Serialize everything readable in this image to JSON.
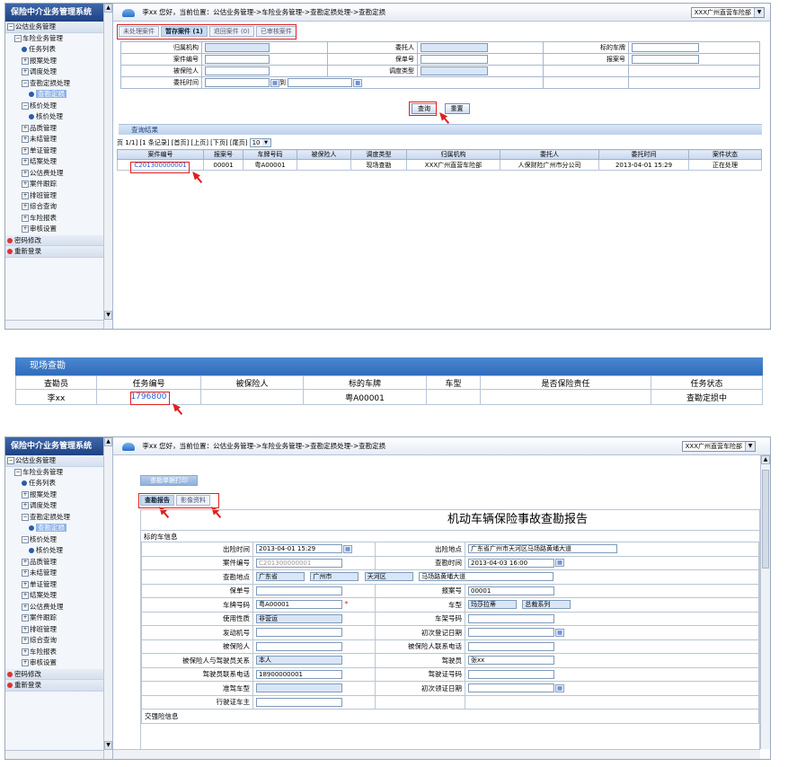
{
  "app": {
    "title": "保险中介业务管理系统",
    "branch_select": "XXX广州直营车险部"
  },
  "sidebar": {
    "items": [
      {
        "label": "公估业务管理",
        "level": 0,
        "icon": "collapse"
      },
      {
        "label": "车险业务管理",
        "level": 1,
        "icon": "collapse"
      },
      {
        "label": "任务列表",
        "level": 2,
        "icon": "dot"
      },
      {
        "label": "报案处理",
        "level": 2,
        "icon": "expand"
      },
      {
        "label": "调度处理",
        "level": 2,
        "icon": "expand"
      },
      {
        "label": "查勘定损处理",
        "level": 2,
        "icon": "collapse"
      },
      {
        "label": "查勘定损",
        "level": 3,
        "icon": "dot",
        "selected": true
      },
      {
        "label": "核价处理",
        "level": 2,
        "icon": "collapse"
      },
      {
        "label": "核价处理",
        "level": 3,
        "icon": "dot"
      },
      {
        "label": "品质管理",
        "level": 2,
        "icon": "expand"
      },
      {
        "label": "未结管理",
        "level": 2,
        "icon": "expand"
      },
      {
        "label": "单证管理",
        "level": 2,
        "icon": "expand"
      },
      {
        "label": "结案处理",
        "level": 2,
        "icon": "expand"
      },
      {
        "label": "公估费处理",
        "level": 2,
        "icon": "expand"
      },
      {
        "label": "案件跟踪",
        "level": 2,
        "icon": "expand"
      },
      {
        "label": "排班管理",
        "level": 2,
        "icon": "expand"
      },
      {
        "label": "综合查询",
        "level": 2,
        "icon": "expand"
      },
      {
        "label": "车险报表",
        "level": 2,
        "icon": "expand"
      },
      {
        "label": "审核设置",
        "level": 2,
        "icon": "expand"
      },
      {
        "label": "密码修改",
        "level": 0,
        "icon": "dot"
      },
      {
        "label": "重新登录",
        "level": 0,
        "icon": "dot"
      }
    ]
  },
  "panel1": {
    "breadcrumb": "李xx 您好，当前位置：公估业务管理->车险业务管理->查勘定损处理->查勘定损",
    "tabs": [
      "未处理案件",
      "暂存案件 (1)",
      "退回案件 (0)",
      "已审核案件"
    ],
    "form": {
      "org_label": "归属机构",
      "principal_label": "委托人",
      "plate_label": "标的车牌",
      "case_label": "案件编号",
      "policy_label": "保单号",
      "report_label": "报案号",
      "insured_label": "被保险人",
      "dispatch_label": "调度类型",
      "time_label": "委托时间",
      "to_label": "到"
    },
    "query_button": "查询",
    "reset_button": "重置",
    "results_title": "查询结果",
    "pager": "页 1/1] [1 条记录] [首页] [上页] [下页] [尾页]",
    "page_size": "10",
    "columns": [
      "案件编号",
      "报案号",
      "车牌号码",
      "被保险人",
      "调度类型",
      "归属机构",
      "委托人",
      "委托时间",
      "案件状态"
    ],
    "rows": [
      [
        "C201300000001",
        "00001",
        "粤A00001",
        "",
        "现场查勘",
        "XXX广州直营车险部",
        "人保财险广州市分公司",
        "2013-04-01 15:29",
        "正在处理"
      ]
    ]
  },
  "field_survey": {
    "title": "现场查勘",
    "columns": [
      "查勘员",
      "任务编号",
      "被保险人",
      "标的车牌",
      "车型",
      "是否保险责任",
      "任务状态"
    ],
    "row": [
      "李xx",
      "1796800",
      "",
      "粤A00001",
      "",
      "",
      "查勘定损中"
    ]
  },
  "panel3": {
    "breadcrumb": "李xx 您好，当前位置：公估业务管理->车险业务管理->查勘定损处理->查勘定损",
    "print_button": "查勘单据打印",
    "tabs": [
      "查勘报告",
      "影像资料"
    ],
    "report_title": "机动车辆保险事故查勘报告",
    "section": "标的车信息",
    "fields": {
      "accident_time_label": "出险时间",
      "accident_time": "2013-04-01 15:29",
      "accident_place_label": "出险地点",
      "accident_place": "广东省广州市天河区马场路黄埔大道",
      "case_no_label": "案件编号",
      "case_no": "C201300000001",
      "survey_time_label": "查勘时间",
      "survey_time": "2013-04-03 16:00",
      "survey_place_label": "查勘地点",
      "province": "广东省",
      "city": "广州市",
      "district": "天河区",
      "street": "马场路黄埔大道",
      "policy_label": "保单号",
      "report_label": "报案号",
      "report_no": "00001",
      "plate_label": "车牌号码",
      "plate": "粤A00001",
      "model_label": "车型",
      "brand": "玛莎拉蒂",
      "series": "总裁系列",
      "usage_label": "使用性质",
      "usage": "非营运",
      "frame_label": "车架号码",
      "engine_label": "发动机号",
      "first_reg_label": "初次登记日期",
      "insured_label": "被保险人",
      "insured_phone_label": "被保险人联系电话",
      "relation_label": "被保险人与驾驶员关系",
      "relation": "本人",
      "driver_label": "驾驶员",
      "driver": "张xx",
      "driver_phone_label": "驾驶员联系电话",
      "driver_phone": "18900000001",
      "license_label": "驾驶证号码",
      "vehicle_class_label": "准驾车型",
      "first_license_label": "初次领证日期",
      "owner_label": "行驶证车主",
      "next_section": "交强险信息"
    }
  }
}
